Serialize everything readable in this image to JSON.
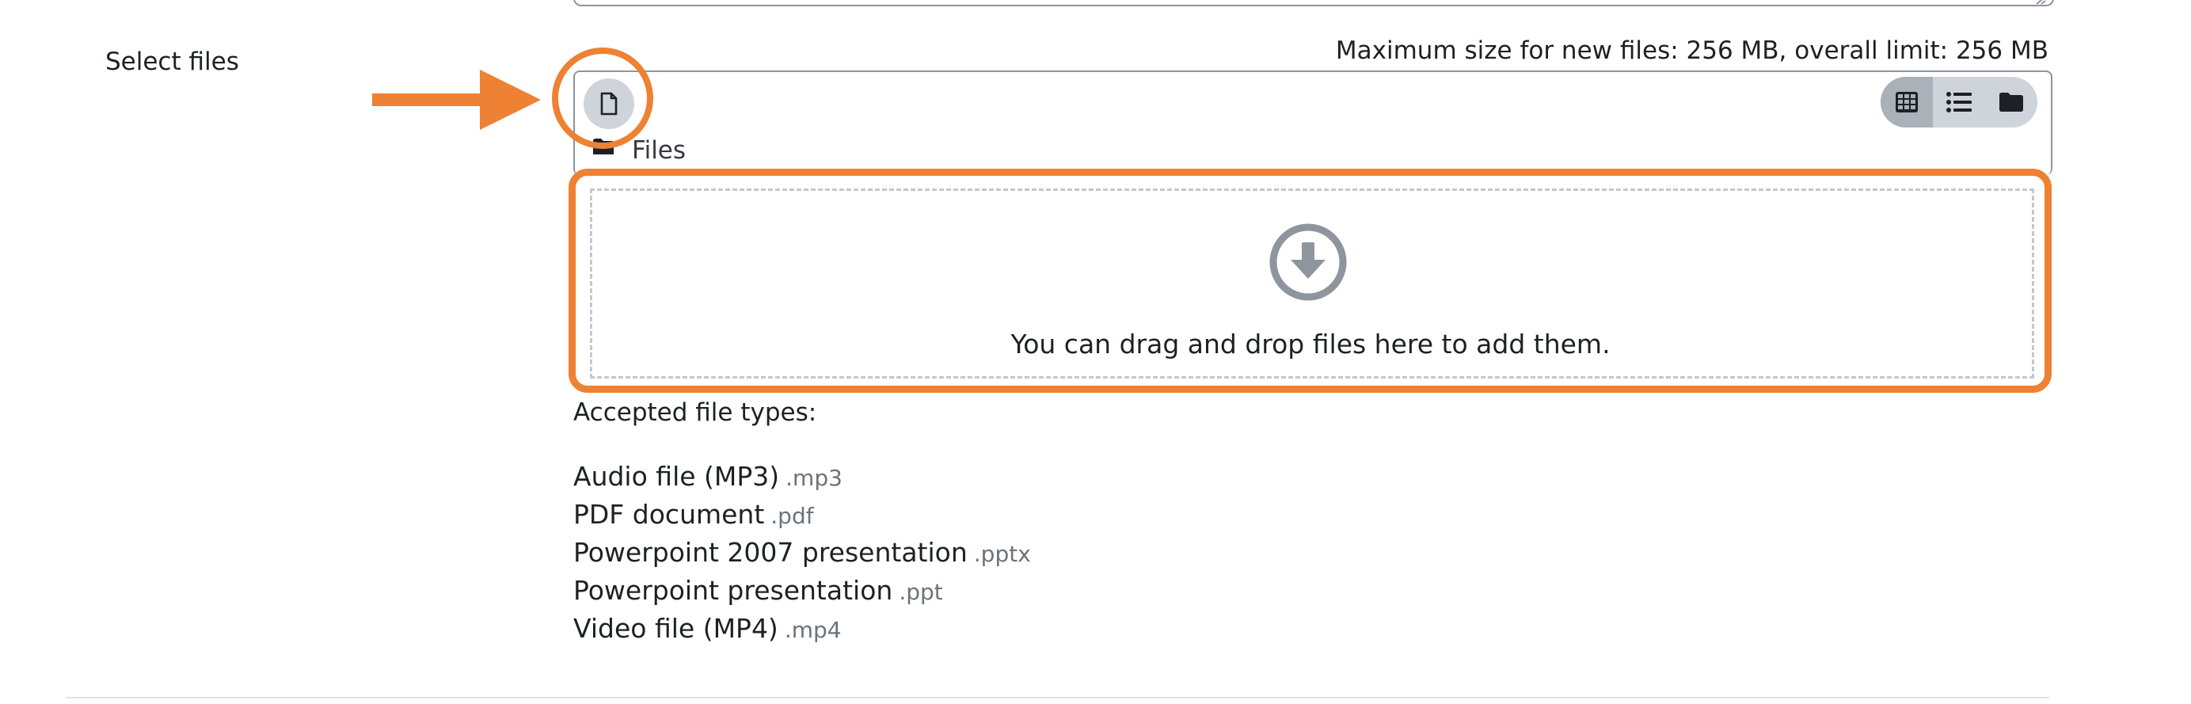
{
  "form": {
    "field_label": "Select files",
    "max_size_text": "Maximum size for new files: 256 MB, overall limit: 256 MB"
  },
  "filemanager": {
    "add_icon": "file-icon",
    "view_buttons": [
      {
        "icon": "grid-icon",
        "active": true
      },
      {
        "icon": "list-icon",
        "active": false
      },
      {
        "icon": "folder-icon",
        "active": false
      }
    ],
    "path_label": "Files",
    "dropzone": {
      "icon": "download-circle-icon",
      "text": "You can drag and drop files here to add them."
    }
  },
  "accepted": {
    "label": "Accepted file types:",
    "types": [
      {
        "name": "Audio file (MP3)",
        "ext": ".mp3"
      },
      {
        "name": "PDF document",
        "ext": ".pdf"
      },
      {
        "name": "Powerpoint 2007 presentation",
        "ext": ".pptx"
      },
      {
        "name": "Powerpoint presentation",
        "ext": ".ppt"
      },
      {
        "name": "Video file (MP4)",
        "ext": ".mp4"
      }
    ]
  },
  "annotations": {
    "color": "#ee8133"
  }
}
